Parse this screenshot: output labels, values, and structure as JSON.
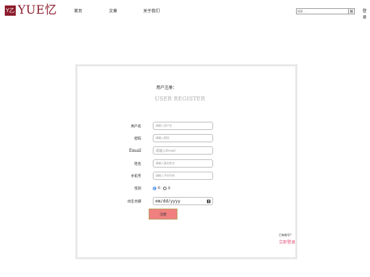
{
  "header": {
    "logo_mark": "Y乙",
    "logo_text": "YUE忆",
    "nav": [
      "首页",
      "文章",
      "关于我们"
    ],
    "search_placeholder": "搜索...",
    "search_button": "搜",
    "login_link": "登录"
  },
  "register": {
    "title": "用户注册：",
    "subtitle": "USER REGISTER",
    "fields": [
      {
        "label": "用户名",
        "placeholder": "请输入用户名"
      },
      {
        "label": "密码",
        "placeholder": "请输入密码"
      },
      {
        "label": "Email",
        "placeholder": "请输入Email"
      },
      {
        "label": "姓名",
        "placeholder": "请输入真实姓名"
      },
      {
        "label": "手机号",
        "placeholder": "请输入手机号码"
      }
    ],
    "gender": {
      "label": "性别",
      "options": [
        "男",
        "女"
      ],
      "selected": "男"
    },
    "birthday": {
      "label": "出生日期",
      "value": "mm/dd/yyyy"
    },
    "submit_label": "注册",
    "have_account": "已有账号?",
    "login_now": "立即登录"
  },
  "colors": {
    "brand": "#8b1c2c",
    "submit_bg": "#f08080",
    "login_link": "#e0507a"
  }
}
